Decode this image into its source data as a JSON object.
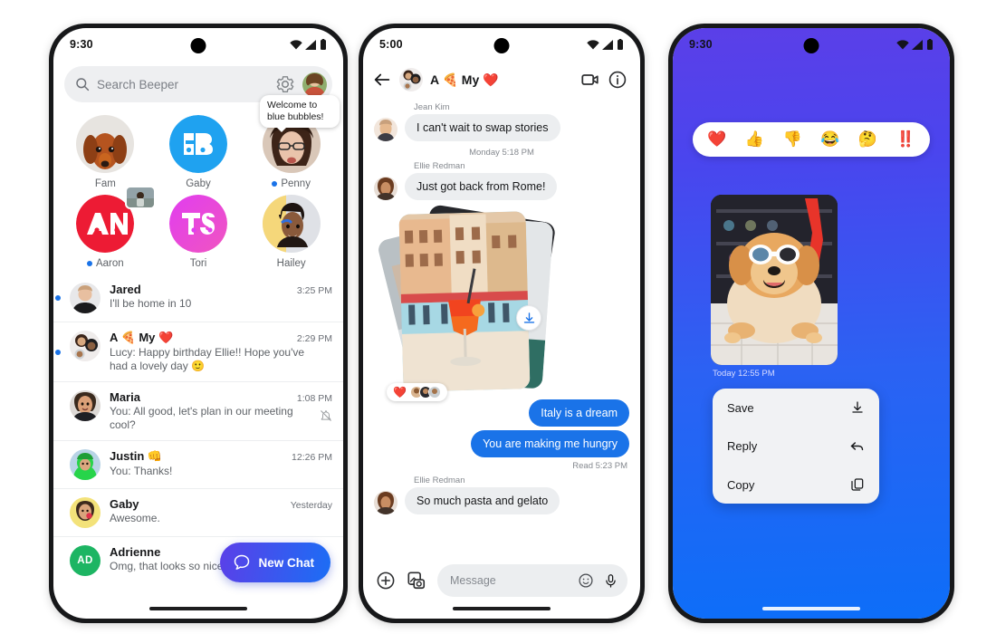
{
  "phone1": {
    "status": {
      "time": "9:30",
      "wifi": "wifi-icon",
      "signal": "signal-icon",
      "battery": "battery-icon"
    },
    "search": {
      "placeholder": "Search Beeper",
      "icon": "search-icon",
      "settings_icon": "gear-icon",
      "avatar": "profile-avatar"
    },
    "favorites": [
      {
        "name": "Fam",
        "unread": false,
        "type": "photo-dog",
        "tooltip": null,
        "badge": false
      },
      {
        "name": "Gaby",
        "unread": false,
        "type": "logo-gb",
        "tooltip": null,
        "badge": false
      },
      {
        "name": "Penny",
        "unread": true,
        "type": "photo-woman",
        "tooltip": "Welcome to blue bubbles!",
        "badge": false
      },
      {
        "name": "Aaron",
        "unread": true,
        "type": "logo-an",
        "tooltip": null,
        "badge": true
      },
      {
        "name": "Tori",
        "unread": false,
        "type": "logo-ts",
        "tooltip": null,
        "badge": false
      },
      {
        "name": "Hailey",
        "unread": false,
        "type": "photo-hailey",
        "tooltip": null,
        "badge": false
      }
    ],
    "chats": [
      {
        "name": "Jared",
        "time": "3:25 PM",
        "preview": "I'll be home in 10",
        "unread": true,
        "muted": false,
        "avatar": "photo-jared"
      },
      {
        "name": "A 🍕 My ❤️",
        "time": "2:29 PM",
        "preview": "Lucy: Happy birthday Ellie!! Hope you've had a lovely day  🙂",
        "unread": true,
        "muted": false,
        "avatar": "group-avatar"
      },
      {
        "name": "Maria",
        "time": "1:08 PM",
        "preview": "You: All good, let's plan in our meeting cool?",
        "unread": false,
        "muted": true,
        "avatar": "photo-maria"
      },
      {
        "name": "Justin 👊",
        "time": "12:26 PM",
        "preview": "You: Thanks!",
        "unread": false,
        "muted": false,
        "avatar": "photo-justin"
      },
      {
        "name": "Gaby",
        "time": "Yesterday",
        "preview": "Awesome.",
        "unread": false,
        "muted": false,
        "avatar": "photo-gaby"
      },
      {
        "name": "Adrienne",
        "time": "",
        "preview": "Omg, that looks so nice!",
        "unread": false,
        "muted": false,
        "avatar": "initials-AD",
        "initials": "AD"
      }
    ],
    "fab": {
      "label": "New Chat",
      "icon": "chat-bubble-icon"
    }
  },
  "phone2": {
    "status": {
      "time": "5:00"
    },
    "header": {
      "back_icon": "back-arrow-icon",
      "title": "A 🍕 My ❤️",
      "video_icon": "video-camera-icon",
      "info_icon": "info-circle-icon"
    },
    "messages": [
      {
        "kind": "incoming",
        "sender": "Jean Kim",
        "text": "I can't wait to swap stories"
      },
      {
        "kind": "daystamp",
        "text": "Monday 5:18 PM"
      },
      {
        "kind": "incoming",
        "sender": "Ellie Redman",
        "text": "Just got back from Rome!"
      },
      {
        "kind": "photostack",
        "reaction": "❤️",
        "download_icon": "download-icon"
      },
      {
        "kind": "outgoing",
        "text": "Italy is a dream"
      },
      {
        "kind": "outgoing",
        "text": "You are making me hungry"
      },
      {
        "kind": "readstamp",
        "text": "Read  5:23 PM"
      },
      {
        "kind": "incoming",
        "sender": "Ellie Redman",
        "text": "So much pasta and gelato"
      }
    ],
    "composer": {
      "plus_icon": "plus-circle-icon",
      "gallery_icon": "gallery-camera-icon",
      "placeholder": "Message",
      "emoji_icon": "emoji-smiley-icon",
      "mic_icon": "microphone-icon"
    }
  },
  "phone3": {
    "status": {
      "time": "9:30"
    },
    "reactions": [
      "❤️",
      "👍",
      "👎",
      "😂",
      "🤔",
      "‼️"
    ],
    "photo": {
      "alt": "dog-with-sunglasses-photo"
    },
    "timestamp": "Today  12:55 PM",
    "menu": [
      {
        "label": "Save",
        "icon": "download-icon"
      },
      {
        "label": "Reply",
        "icon": "reply-arrow-icon"
      },
      {
        "label": "Copy",
        "icon": "copy-icon"
      }
    ],
    "gradient": {
      "from": "#5b3fe8",
      "to": "#0d6ef8"
    }
  },
  "colors": {
    "accent_blue": "#1a73e8",
    "bubble_in": "#eceef0",
    "fab_from": "#5b3fe8",
    "fab_to": "#1b6ef5",
    "gaby_logo": "#1fa2f0",
    "aaron_logo": "#ed1b34",
    "tori_logo": "#e13df0",
    "adrienne_avatar": "#1db563"
  }
}
